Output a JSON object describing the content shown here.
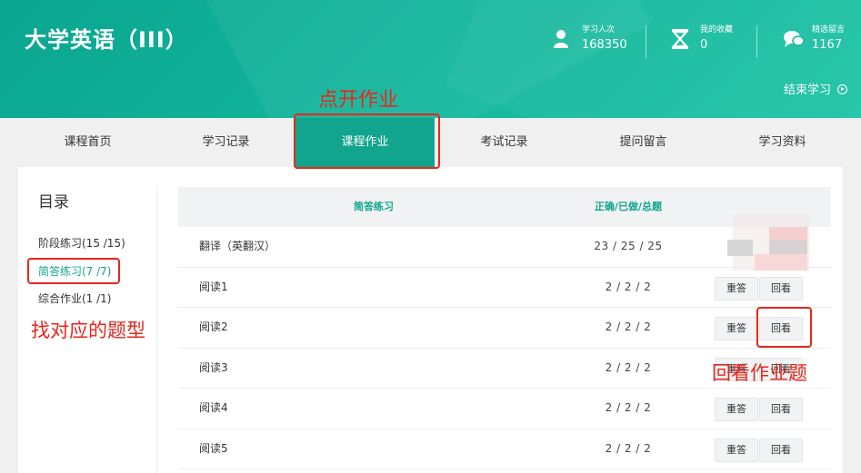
{
  "header": {
    "course_title": "大学英语（III）",
    "stats": [
      {
        "label": "学习人次",
        "value": "168350",
        "icon": "user-icon"
      },
      {
        "label": "我的收藏",
        "value": "0",
        "icon": "hourglass-icon"
      },
      {
        "label": "精选留言",
        "value": "1167",
        "icon": "chat-icon"
      }
    ],
    "end_study_label": "结束学习"
  },
  "nav": {
    "tabs": [
      {
        "label": "课程首页"
      },
      {
        "label": "学习记录"
      },
      {
        "label": "课程作业",
        "active": true
      },
      {
        "label": "考试记录"
      },
      {
        "label": "提问留言"
      },
      {
        "label": "学习资料"
      }
    ]
  },
  "sidebar": {
    "title": "目录",
    "items": [
      {
        "label": "阶段练习(15 /15)"
      },
      {
        "label": "简答练习(7 /7)",
        "active": true
      },
      {
        "label": "综合作业(1 /1)"
      }
    ]
  },
  "table": {
    "headers": {
      "name": "简答练习",
      "score": "正确/已做/总题"
    },
    "rows": [
      {
        "name": "翻译（英翻汉）",
        "score": "23 / 25 / 25"
      },
      {
        "name": "阅读1",
        "score": "2 / 2 / 2",
        "redo": "重答",
        "review": "回看"
      },
      {
        "name": "阅读2",
        "score": "2 / 2 / 2",
        "redo": "重答",
        "review": "回看"
      },
      {
        "name": "阅读3",
        "score": "2 / 2 / 2",
        "redo": "重答",
        "review": "回看"
      },
      {
        "name": "阅读4",
        "score": "2 / 2 / 2",
        "redo": "重答",
        "review": "回看"
      },
      {
        "name": "阅读5",
        "score": "2 / 2 / 2",
        "redo": "重答",
        "review": "回看"
      }
    ]
  },
  "annotations": {
    "open_homework": "点开作业",
    "find_type": "找对应的题型",
    "review_homework": "回看作业题"
  },
  "colors": {
    "primary": "#11a58d",
    "annotation_red": "#e8261c"
  }
}
